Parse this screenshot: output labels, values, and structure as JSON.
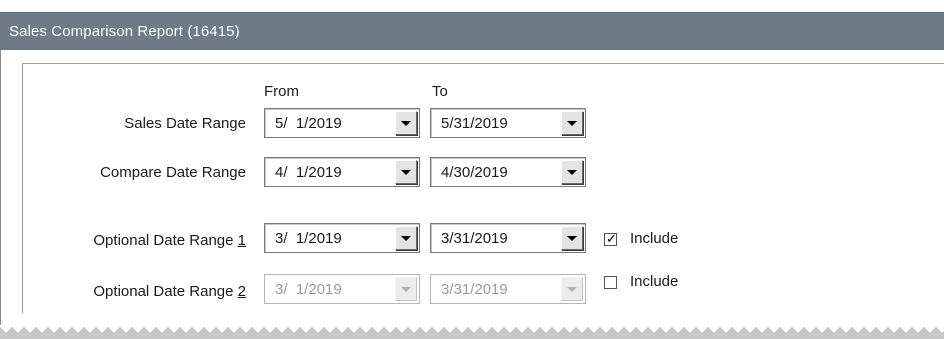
{
  "window": {
    "title": "Sales Comparison Report (16415)"
  },
  "columns": {
    "from_label": "From",
    "to_label": "To"
  },
  "rows": [
    {
      "label": "Sales Date Range",
      "from": "5/  1/2019",
      "to": "5/31/2019",
      "enabled": true
    },
    {
      "label": "Compare Date Range",
      "from": "4/  1/2019",
      "to": "4/30/2019",
      "enabled": true
    },
    {
      "label_prefix": "Optional Date Range ",
      "label_accel": "1",
      "from": "3/  1/2019",
      "to": "3/31/2019",
      "enabled": true,
      "include_label": "Include",
      "include_checked": true
    },
    {
      "label_prefix": "Optional Date Range ",
      "label_accel": "2",
      "from": "3/  1/2019",
      "to": "3/31/2019",
      "enabled": false,
      "include_label": "Include",
      "include_checked": false
    }
  ],
  "icons": {
    "dropdown": "chevron-down-icon",
    "checkmark": "check-icon"
  },
  "colors": {
    "titlebar": "#6e7a86",
    "title_text": "#ffffff",
    "disabled_text": "#9a9a9a"
  }
}
